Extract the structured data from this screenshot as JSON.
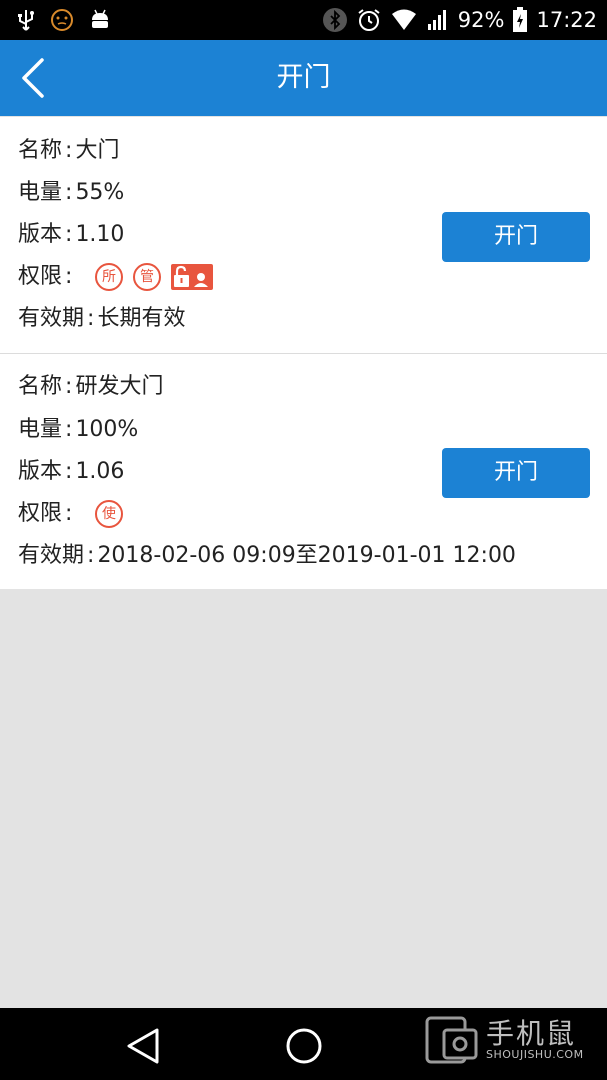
{
  "status_bar": {
    "battery": "92%",
    "time": "17:22",
    "left_icons": [
      "usb-icon",
      "face-icon",
      "android-icon"
    ],
    "right_icons": [
      "bluetooth-icon",
      "alarm-icon",
      "wifi-icon",
      "signal-icon",
      "battery-icon"
    ]
  },
  "header": {
    "title": "开门",
    "back_icon": "chevron-left-icon"
  },
  "devices": [
    {
      "name_label": "名称",
      "name": "大门",
      "battery_label": "电量",
      "battery": "55%",
      "version_label": "版本",
      "version": "1.10",
      "perm_label": "权限",
      "perm_badges": [
        "所",
        "管"
      ],
      "validity_label": "有效期",
      "validity": "长期有效",
      "button": "开门"
    },
    {
      "name_label": "名称",
      "name": "研发大门",
      "battery_label": "电量",
      "battery": "100%",
      "version_label": "版本",
      "version": "1.06",
      "perm_label": "权限",
      "perm_badges": [
        "使"
      ],
      "validity_label": "有效期",
      "validity": "2018-02-06 09:09至2019-01-01 12:00",
      "button": "开门"
    }
  ],
  "colors": {
    "header": "#1c82d4",
    "button": "#1c82d4",
    "badge": "#e8553e",
    "background": "#e3e3e3"
  },
  "watermark": {
    "big": "手机鼠",
    "small": "SHOUJISHU.COM"
  }
}
